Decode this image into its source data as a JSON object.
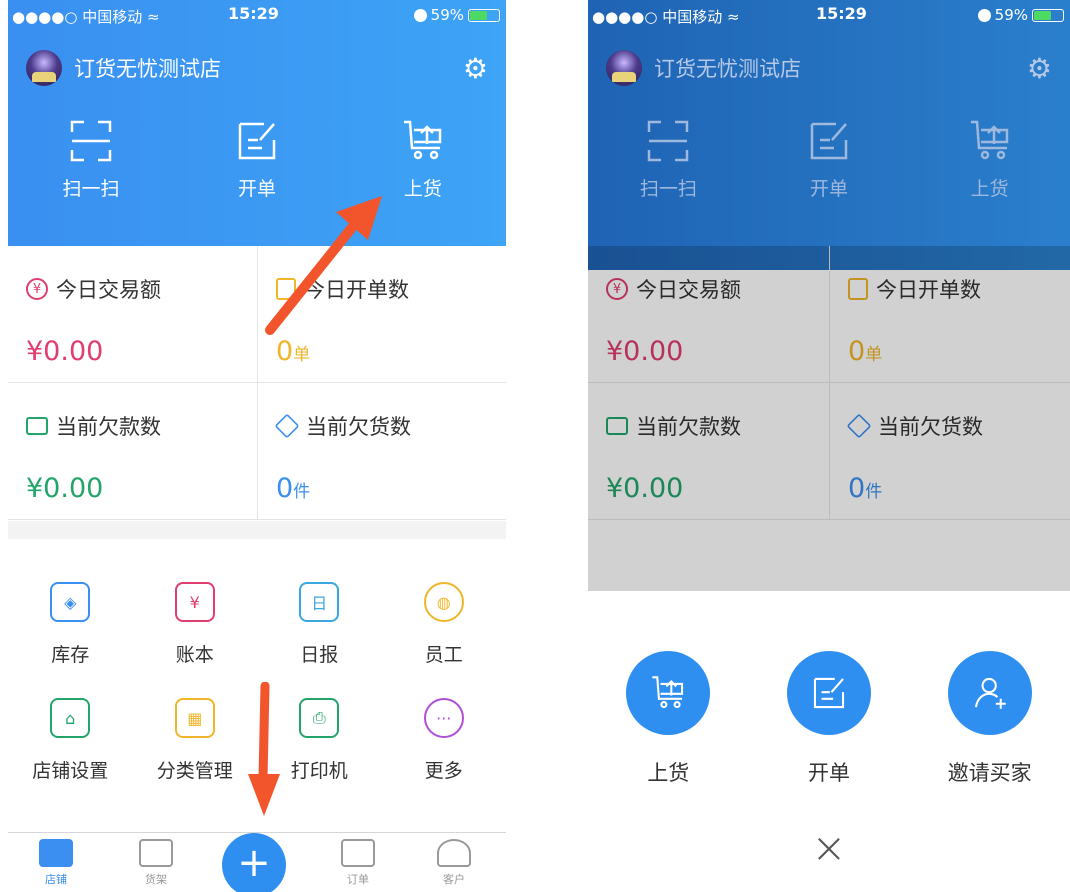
{
  "status": {
    "carrier": "●●●●○ 中国移动 ≈",
    "time": "15:29",
    "battery": "59%"
  },
  "shop": {
    "name": "订货无忧测试店"
  },
  "actions": [
    {
      "label": "扫一扫"
    },
    {
      "label": "开单"
    },
    {
      "label": "上货"
    }
  ],
  "stats": [
    {
      "title": "今日交易额",
      "value": "¥0.00",
      "unit": "",
      "color": "#e03e6e"
    },
    {
      "title": "今日开单数",
      "value": "0",
      "unit": "单",
      "color": "#f0b52a"
    },
    {
      "title": "当前欠款数",
      "value": "¥0.00",
      "unit": "",
      "color": "#23a56a"
    },
    {
      "title": "当前欠货数",
      "value": "0",
      "unit": "件",
      "color": "#3a8ff0"
    }
  ],
  "tools": [
    {
      "label": "库存",
      "glyph": "◈",
      "color": "#3a8ff0"
    },
    {
      "label": "账本",
      "glyph": "¥",
      "color": "#e03e6e"
    },
    {
      "label": "日报",
      "glyph": "日",
      "color": "#3aa8e0"
    },
    {
      "label": "员工",
      "glyph": "◍",
      "color": "#f0b52a"
    },
    {
      "label": "店铺设置",
      "glyph": "⌂",
      "color": "#23a56a"
    },
    {
      "label": "分类管理",
      "glyph": "▦",
      "color": "#f0b52a"
    },
    {
      "label": "打印机",
      "glyph": "⎙",
      "color": "#23a56a"
    },
    {
      "label": "更多",
      "glyph": "···",
      "color": "#b04fd6"
    }
  ],
  "tabs": [
    {
      "label": "店铺"
    },
    {
      "label": "货架"
    },
    {
      "label": "订单"
    },
    {
      "label": "客户"
    }
  ],
  "fab": "+",
  "quick": [
    {
      "label": "上货"
    },
    {
      "label": "开单"
    },
    {
      "label": "邀请买家"
    }
  ],
  "close": "×",
  "colors": {
    "accent": "#2f8ff0",
    "arrow": "#f2552c"
  }
}
